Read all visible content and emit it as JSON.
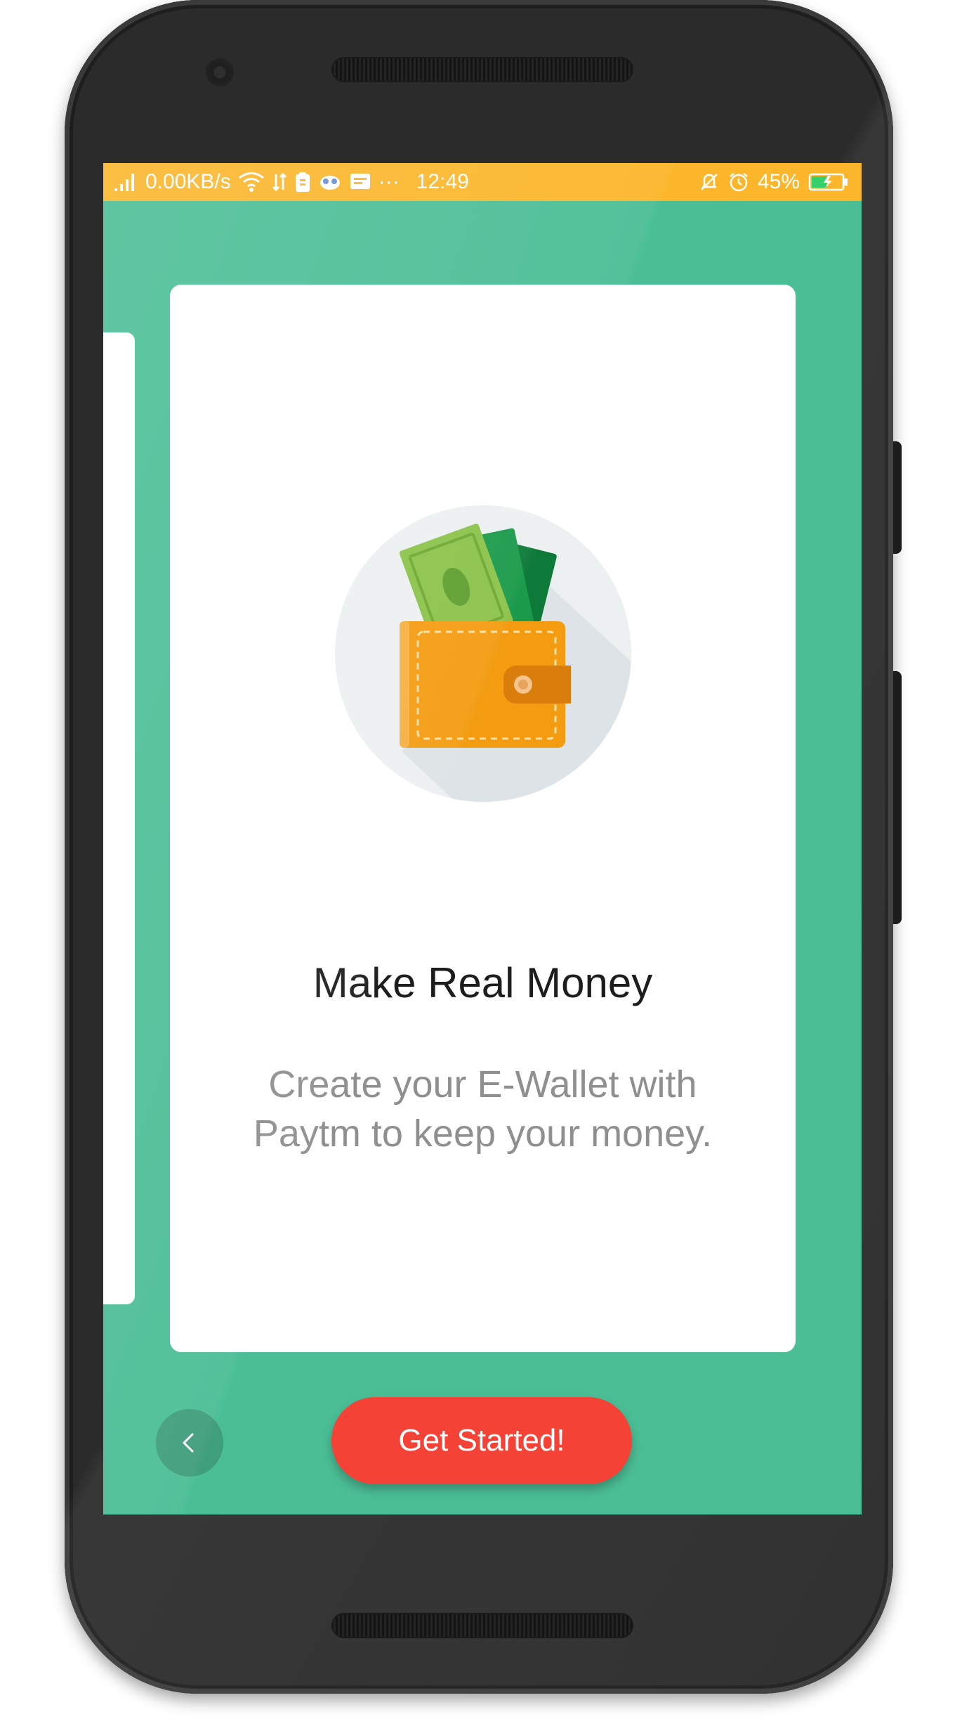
{
  "status_bar": {
    "network_speed": "0.00KB/s",
    "time": "12:49",
    "more_indicator": "···",
    "battery_percent": "45%",
    "background_color": "#fbb62b"
  },
  "screen": {
    "background_color": "#4bbe96"
  },
  "onboarding_card": {
    "illustration_icon": "wallet-with-cash-icon",
    "title": "Make Real Money",
    "description": "Create your E-Wallet with Paytm to keep your money."
  },
  "actions": {
    "back_icon": "chevron-left-icon",
    "get_started_label": "Get Started!",
    "get_started_color": "#f44336"
  }
}
